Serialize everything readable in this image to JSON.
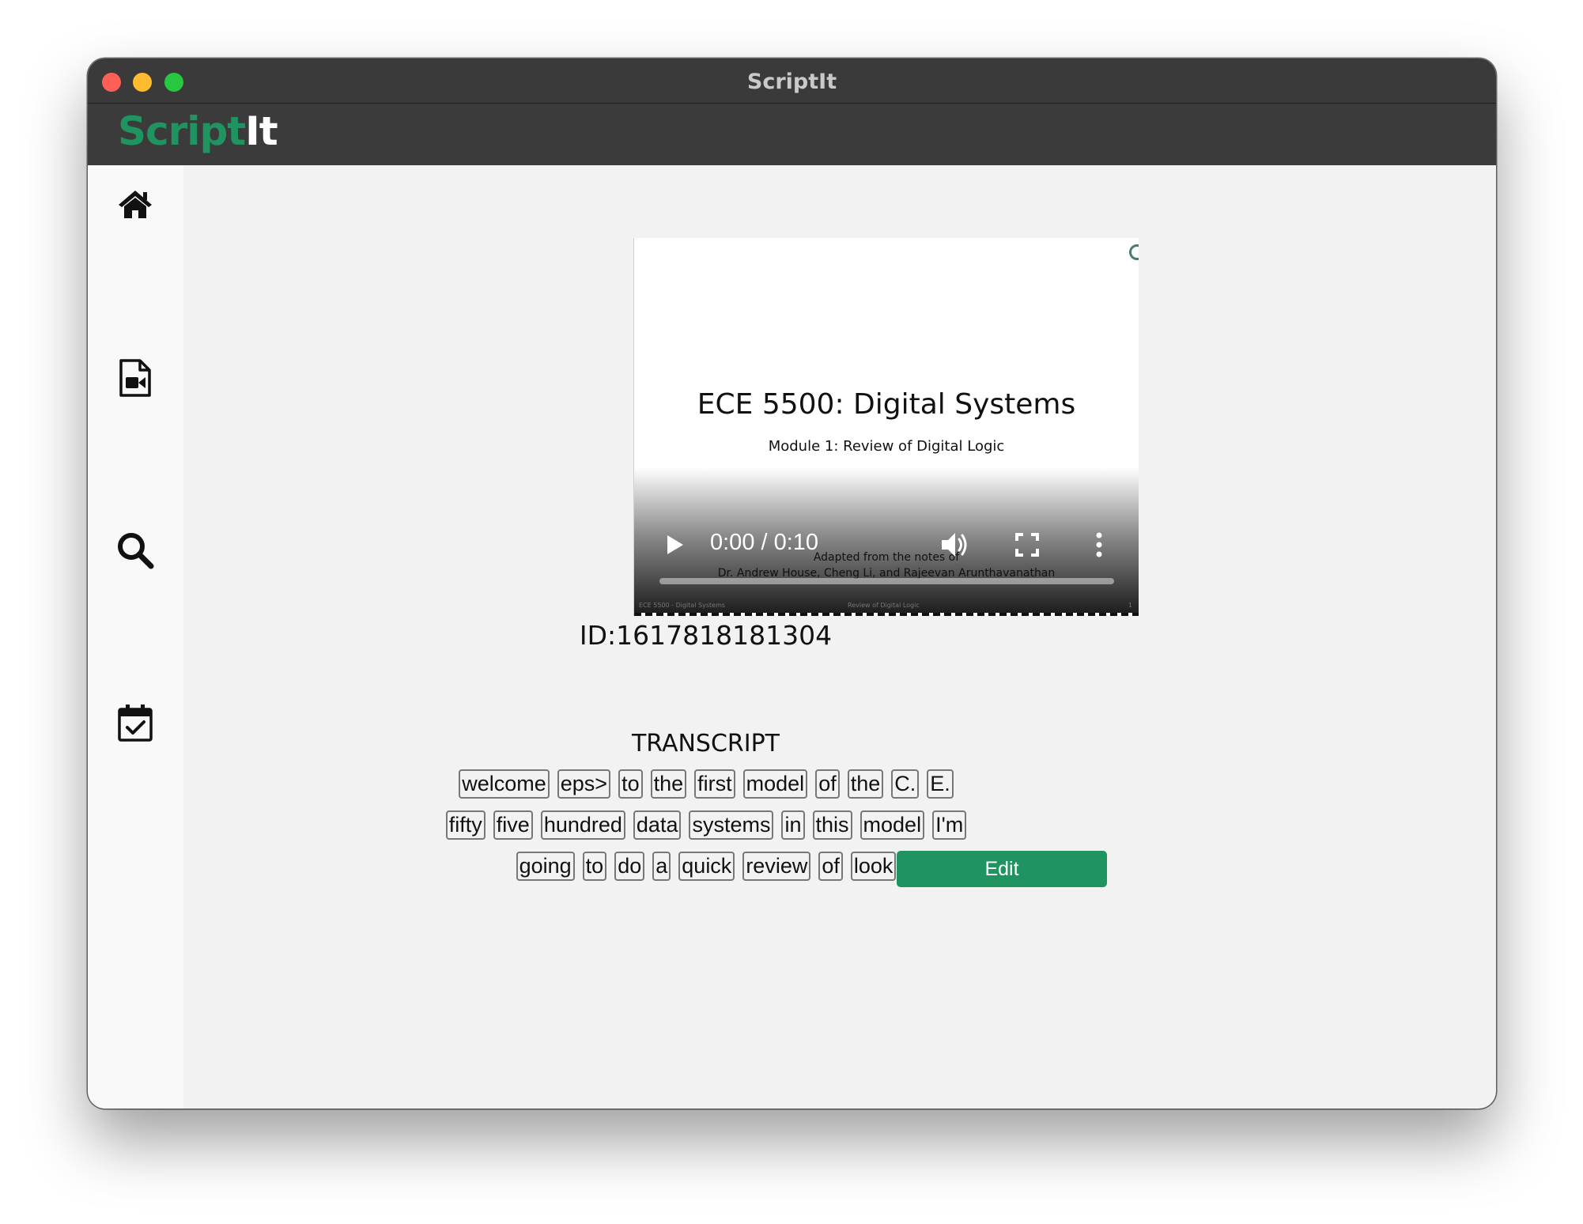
{
  "window": {
    "title": "ScriptIt"
  },
  "app": {
    "logo_part1": "Script",
    "logo_part2": "It"
  },
  "sidebar": {
    "items": [
      {
        "name": "home",
        "icon": "home-icon"
      },
      {
        "name": "video-file",
        "icon": "video-file-icon"
      },
      {
        "name": "search",
        "icon": "search-icon"
      },
      {
        "name": "calendar",
        "icon": "calendar-check-icon"
      }
    ]
  },
  "video": {
    "slide_title": "ECE 5500: Digital Systems",
    "slide_subtitle": "Module 1: Review of Digital Logic",
    "slide_adapted_line1": "Adapted from the notes of",
    "slide_adapted_line2": "Dr. Andrew House, Cheng Li, and Rajeevan Arunthavanathan",
    "slide_footer_left": "ECE 5500 - Digital Systems",
    "slide_footer_center": "Review of Digital Logic",
    "slide_footer_right": "1",
    "time": "0:00 / 0:10",
    "progress": 0
  },
  "video_id": "ID:1617818181304",
  "transcript": {
    "heading": "TRANSCRIPT",
    "words": [
      "welcome",
      "eps>",
      "to",
      "the",
      "first",
      "model",
      "of",
      "the",
      "C.",
      "E.",
      "fifty",
      "five",
      "hundred",
      "data",
      "systems",
      "in",
      "this",
      "model",
      "I'm",
      "going",
      "to",
      "do",
      "a",
      "quick",
      "review",
      "of",
      "look"
    ],
    "edit_label": "Edit"
  },
  "colors": {
    "accent": "#1f9460",
    "header": "#3b3b3b",
    "background": "#f2f2f2"
  }
}
